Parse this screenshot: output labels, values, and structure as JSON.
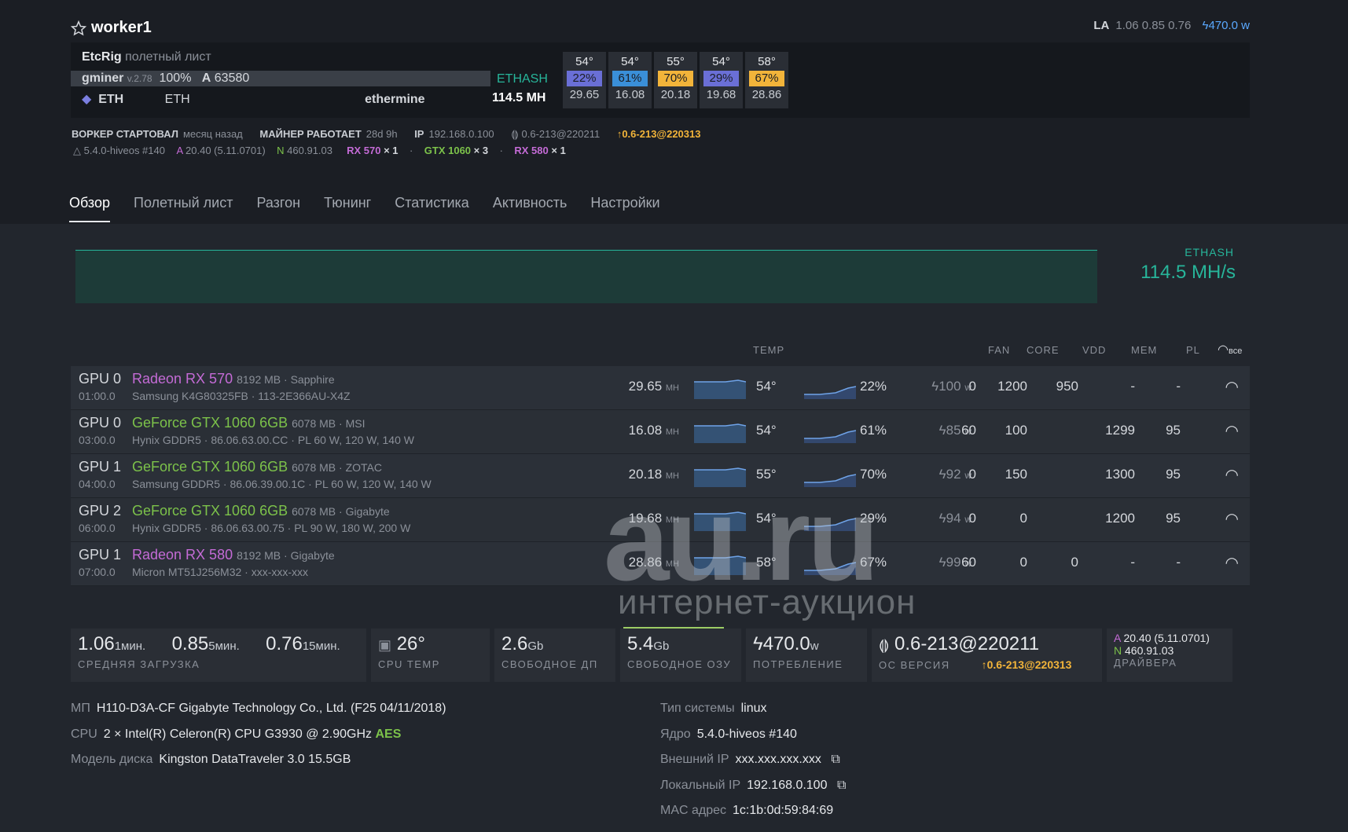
{
  "worker": {
    "name": "worker1",
    "la_label": "LA",
    "la": "1.06 0.85 0.76",
    "power": "470.0",
    "power_unit": "w"
  },
  "flight": {
    "rig": "EtcRig",
    "sheet": "полетный лист",
    "miner": "gminer",
    "miner_ver": "v.2.78",
    "percent": "100%",
    "a_label": "A",
    "accepted": "63580",
    "algo": "ETHASH",
    "coin": "ETH",
    "coin2": "ETH",
    "pool": "ethermine",
    "hashrate": "114.5 MH",
    "gpus": [
      {
        "temp": "54°",
        "fan": "22%",
        "fan_color": "#6a6fd6",
        "hr": "29.65"
      },
      {
        "temp": "54°",
        "fan": "61%",
        "fan_color": "#3a8fd8",
        "hr": "16.08"
      },
      {
        "temp": "55°",
        "fan": "70%",
        "fan_color": "#f2b43a",
        "hr": "20.18"
      },
      {
        "temp": "54°",
        "fan": "29%",
        "fan_color": "#6a6fd6",
        "hr": "19.68"
      },
      {
        "temp": "58°",
        "fan": "67%",
        "fan_color": "#f2b43a",
        "hr": "28.86"
      }
    ]
  },
  "info": {
    "started_label": "ВОРКЕР СТАРТОВАЛ",
    "started": "месяц назад",
    "miner_label": "МАЙНЕР РАБОТАЕТ",
    "miner_time": "28d 9h",
    "ip_label": "IP",
    "ip": "192.168.0.100",
    "version": "0.6-213@220211",
    "update": "0.6-213@220313",
    "kernel": "5.4.0-hiveos #140",
    "amd_label": "A",
    "amd": "20.40 (5.11.0701)",
    "nv_label": "N",
    "nv": "460.91.03",
    "gpu_sum": [
      {
        "name": "RX 570",
        "count": "× 1",
        "color": "#c46bd6"
      },
      {
        "name": "GTX 1060",
        "count": "× 3",
        "color": "#7cc24a"
      },
      {
        "name": "RX 580",
        "count": "× 1",
        "color": "#c46bd6"
      }
    ],
    "dot": "·"
  },
  "tabs": [
    "Обзор",
    "Полетный лист",
    "Разгон",
    "Тюнинг",
    "Статистика",
    "Активность",
    "Настройки"
  ],
  "graph": {
    "algo": "ETHASH",
    "hashrate": "114.5 MH/s"
  },
  "columns": {
    "temp": "TEMP",
    "fan": "FAN",
    "core": "CORE",
    "vdd": "VDD",
    "mem": "MEM",
    "pl": "PL",
    "all": "все"
  },
  "gpus": [
    {
      "id": "GPU 0",
      "bus": "01:00.0",
      "name": "Radeon RX 570",
      "color": "#c46bd6",
      "mem": "8192 MB · Sapphire",
      "sub": "Samsung K4G80325FB · 113-2E366AU-X4Z",
      "hr": "29.65",
      "hr_unit": "MH",
      "temp": "54°",
      "fan": "22%",
      "power": "100",
      "power_unit": "w",
      "fanv": "0",
      "core": "1200",
      "vdd": "950",
      "memc": "-",
      "pl": "-"
    },
    {
      "id": "GPU 0",
      "bus": "03:00.0",
      "name": "GeForce GTX 1060 6GB",
      "color": "#7cc24a",
      "mem": "6078 MB · MSI",
      "sub": "Hynix GDDR5 · 86.06.63.00.CC · PL 60 W, 120 W, 140 W",
      "hr": "16.08",
      "hr_unit": "MH",
      "temp": "54°",
      "fan": "61%",
      "power": "85",
      "power_unit": "w",
      "fanv": "60",
      "core": "100",
      "vdd": "",
      "memc": "1299",
      "pl": "95"
    },
    {
      "id": "GPU 1",
      "bus": "04:00.0",
      "name": "GeForce GTX 1060 6GB",
      "color": "#7cc24a",
      "mem": "6078 MB · ZOTAC",
      "sub": "Samsung GDDR5 · 86.06.39.00.1C · PL 60 W, 120 W, 140 W",
      "hr": "20.18",
      "hr_unit": "MH",
      "temp": "55°",
      "fan": "70%",
      "power": "92",
      "power_unit": "w",
      "fanv": "0",
      "core": "150",
      "vdd": "",
      "memc": "1300",
      "pl": "95"
    },
    {
      "id": "GPU 2",
      "bus": "06:00.0",
      "name": "GeForce GTX 1060 6GB",
      "color": "#7cc24a",
      "mem": "6078 MB · Gigabyte",
      "sub": "Hynix GDDR5 · 86.06.63.00.75 · PL 90 W, 180 W, 200 W",
      "hr": "19.68",
      "hr_unit": "MH",
      "temp": "54°",
      "fan": "29%",
      "power": "94",
      "power_unit": "w",
      "fanv": "0",
      "core": "0",
      "vdd": "",
      "memc": "1200",
      "pl": "95"
    },
    {
      "id": "GPU 1",
      "bus": "07:00.0",
      "name": "Radeon RX 580",
      "color": "#c46bd6",
      "mem": "8192 MB · Gigabyte",
      "sub": "Micron MT51J256M32 · xxx-xxx-xxx",
      "hr": "28.86",
      "hr_unit": "MH",
      "temp": "58°",
      "fan": "67%",
      "power": "99",
      "power_unit": "w",
      "fanv": "60",
      "core": "0",
      "vdd": "0",
      "memc": "-",
      "pl": "-"
    }
  ],
  "stats": {
    "la1": "1.06",
    "la1u": "1мин.",
    "la5": "0.85",
    "la5u": "5мин.",
    "la15": "0.76",
    "la15u": "15мин.",
    "la_label": "СРЕДНЯЯ ЗАГРУЗКА",
    "cpu_temp": "26°",
    "cpu_label": "CPU TEMP",
    "disk": "2.6",
    "disk_u": "Gb",
    "disk_label": "СВОБОДНОЕ ДП",
    "ram": "5.4",
    "ram_u": "Gb",
    "ram_label": "СВОБОДНОЕ ОЗУ",
    "power": "470.0",
    "power_u": "w",
    "power_label": "ПОТРЕБЛЕНИЕ",
    "os": "0.6-213@220211",
    "os_label": "ОС ВЕРСИЯ",
    "os_update": "0.6-213@220313",
    "drv_a_label": "A",
    "drv_a": "20.40 (5.11.0701)",
    "drv_n_label": "N",
    "drv_n": "460.91.03",
    "drv_label": "ДРАЙВЕРА"
  },
  "specs": {
    "mb_label": "МП",
    "mb": "H110-D3A-CF Gigabyte Technology Co., Ltd. (F25 04/11/2018)",
    "cpu_label": "CPU",
    "cpu": "2 × Intel(R) Celeron(R) CPU G3930 @ 2.90GHz",
    "aes": "AES",
    "disk_label": "Модель диска",
    "disk": "Kingston DataTraveler 3.0 15.5GB",
    "os_label": "Тип системы",
    "os": "linux",
    "kernel_label": "Ядро",
    "kernel": "5.4.0-hiveos #140",
    "ext_ip_label": "Внешний IP",
    "ext_ip": "xxx.xxx.xxx.xxx",
    "local_ip_label": "Локальный IP",
    "local_ip": "192.168.0.100",
    "mac_label": "MAC адрес",
    "mac": "1c:1b:0d:59:84:69"
  },
  "watermark": {
    "logo": "au.ru",
    "tagline": "интернет-аукцион"
  }
}
